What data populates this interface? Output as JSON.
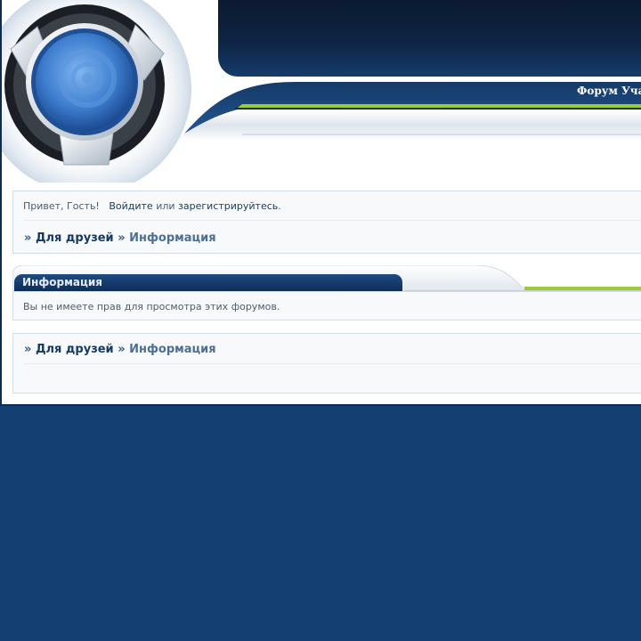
{
  "header": {
    "forum_title": "Форум Учас"
  },
  "welcome": {
    "greeting": "Привет, Гость!",
    "login_link": "Войдите",
    "or_text": "или",
    "register_link": "зарегистрируйтесь",
    "period": "."
  },
  "breadcrumb": {
    "separator": "»",
    "items": [
      "Для друзей",
      "Информация"
    ]
  },
  "info_section": {
    "title": "Информация",
    "message": "Вы не имеете прав для просмотра этих форумов."
  },
  "colors": {
    "page_background": "#133f72",
    "header_dark": "#0d2444",
    "accent_green": "#9acd32",
    "link_dark": "#163a63",
    "link_muted": "#4d6f94"
  }
}
